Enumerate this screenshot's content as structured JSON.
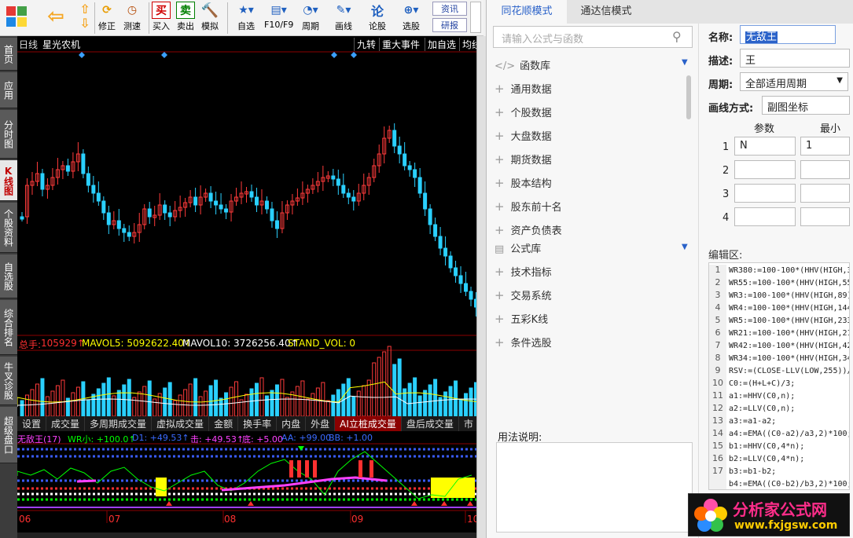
{
  "toolbar": {
    "buttons": [
      {
        "label": "修正",
        "icon": "refresh-icon"
      },
      {
        "label": "测速",
        "icon": "clock-icon"
      },
      {
        "label": "买入",
        "icon": "buy-icon"
      },
      {
        "label": "卖出",
        "icon": "sell-icon"
      },
      {
        "label": "模拟",
        "icon": "gavel-icon"
      },
      {
        "label": "自选",
        "icon": "star-icon"
      },
      {
        "label": "F10/F9",
        "icon": "f10-icon"
      },
      {
        "label": "周期",
        "icon": "period-icon"
      },
      {
        "label": "画线",
        "icon": "pencil-icon"
      },
      {
        "label": "论股",
        "icon": "chat-icon"
      },
      {
        "label": "选股",
        "icon": "search-icon"
      }
    ],
    "news": "资讯",
    "research": "研报"
  },
  "left_tabs": [
    "首页",
    "应用",
    "分时图",
    "K线图",
    "个股资料",
    "自选股",
    "综合排名",
    "牛叉诊股",
    "超级盘口"
  ],
  "chart": {
    "period": "日线",
    "stock": "星光农机",
    "top_buttons": [
      "九转",
      "重大事件",
      "加自选",
      "均线"
    ],
    "vol_line": {
      "total_label": "总手:",
      "total": "105929↑",
      "mavol5": "MAVOL5: 5092622.40↑",
      "mavol10": "MAVOL10: 3726256.40↑",
      "stand": "STAND_VOL: 0"
    },
    "tabs": [
      "设置",
      "成交量",
      "多周期成交量",
      "虚拟成交量",
      "金额",
      "换手率",
      "内盘",
      "外盘",
      "AI立桩成交量",
      "盘后成交量",
      "市"
    ],
    "indicator": {
      "name": "无敌王(17)",
      "wr": "WR小: +100.0↑",
      "d1": "D1: +49.53↑",
      "hit": "击: +49.53↑",
      "bottom": "底: +5.00",
      "aa": "AA: +99.00",
      "bb": "BB: +1.00"
    },
    "months": [
      "06",
      "07",
      "08",
      "09",
      "10"
    ]
  },
  "panel": {
    "modes": [
      "同花顺模式",
      "通达信模式"
    ],
    "search_placeholder": "请输入公式与函数",
    "func_lib": "函数库",
    "func_items": [
      "通用数据",
      "个股数据",
      "大盘数据",
      "期货数据",
      "股本结构",
      "股东前十名",
      "资产负债表"
    ],
    "formula_lib": "公式库",
    "formula_items": [
      "技术指标",
      "交易系统",
      "五彩K线",
      "条件选股"
    ],
    "usage_label": "用法说明:",
    "name_label": "名称:",
    "name_value": "无敌王",
    "desc_label": "描述:",
    "desc_value": "王",
    "period_label": "周期:",
    "period_value": "全部适用周期",
    "draw_label": "画线方式:",
    "draw_value": "副图坐标",
    "param_header": "参数",
    "min_header": "最小",
    "params": [
      {
        "n": "1",
        "name": "N",
        "min": "1"
      },
      {
        "n": "2",
        "name": "",
        "min": ""
      },
      {
        "n": "3",
        "name": "",
        "min": ""
      },
      {
        "n": "4",
        "name": "",
        "min": ""
      }
    ],
    "editor_label": "编辑区:",
    "code_lines": [
      {
        "n": "1",
        "t": "WR380:=100-100*(HHV(HIGH,3"
      },
      {
        "n": "2",
        "t": "WR55:=100-100*(HHV(HIGH,55"
      },
      {
        "n": "3",
        "t": "WR3:=100-100*(HHV(HIGH,89)"
      },
      {
        "n": "4",
        "t": "WR4:=100-100*(HHV(HIGH,144"
      },
      {
        "n": "5",
        "t": "WR5:=100-100*(HHV(HIGH,233"
      },
      {
        "n": "6",
        "t": "WR21:=100-100*(HHV(HIGH,21"
      },
      {
        "n": "7",
        "t": "WR42:=100-100*(HHV(HIGH,42"
      },
      {
        "n": "8",
        "t": "WR34:=100-100*(HHV(HIGH,34"
      },
      {
        "n": "9",
        "t": "RSV:=(CLOSE-LLV(LOW,255))/"
      },
      {
        "n": "10",
        "t": "C0:=(H+L+C)/3;"
      },
      {
        "n": "11",
        "t": "a1:=HHV(C0,n);"
      },
      {
        "n": "12",
        "t": "a2:=LLV(C0,n);"
      },
      {
        "n": "13",
        "t": "a3:=a1-a2;"
      },
      {
        "n": "14",
        "t": "a4:=EMA((C0-a2)/a3,2)*100;"
      },
      {
        "n": "15",
        "t": "b1:=HHV(C0,4*n);"
      },
      {
        "n": "16",
        "t": "b2:=LLV(C0,4*n);"
      },
      {
        "n": "17",
        "t": "b3:=b1-b2;"
      },
      {
        "n": "",
        "t": "b4:=EMA((C0-b2)/b3,2)*100;"
      }
    ],
    "watermark_cn": "分析家公式网",
    "watermark_url": "www.fxjgsw.com"
  }
}
